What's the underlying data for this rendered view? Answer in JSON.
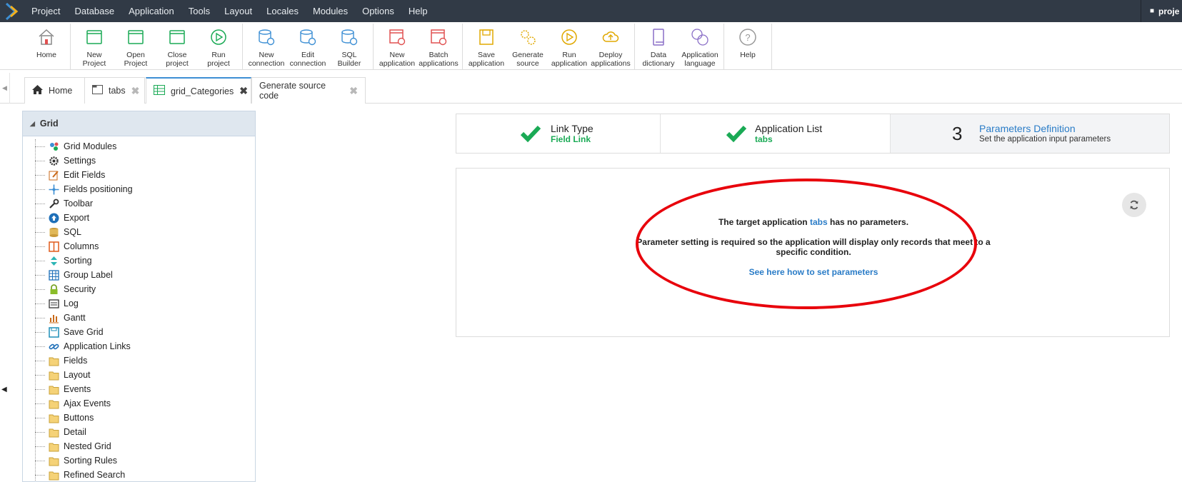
{
  "menu": [
    "Project",
    "Database",
    "Application",
    "Tools",
    "Layout",
    "Locales",
    "Modules",
    "Options",
    "Help"
  ],
  "project_tab": "proje",
  "toolbar": {
    "groups": [
      [
        {
          "l1": "Home",
          "l2": "",
          "icon": "home-icon"
        }
      ],
      [
        {
          "l1": "New",
          "l2": "Project",
          "icon": "new-project-icon"
        },
        {
          "l1": "Open",
          "l2": "Project",
          "icon": "open-project-icon"
        },
        {
          "l1": "Close",
          "l2": "project",
          "icon": "close-project-icon"
        },
        {
          "l1": "Run",
          "l2": "project",
          "icon": "run-project-icon"
        }
      ],
      [
        {
          "l1": "New",
          "l2": "connection",
          "icon": "new-connection-icon"
        },
        {
          "l1": "Edit",
          "l2": "connection",
          "icon": "edit-connection-icon"
        },
        {
          "l1": "SQL",
          "l2": "Builder",
          "icon": "sql-builder-icon"
        }
      ],
      [
        {
          "l1": "New",
          "l2": "application",
          "icon": "new-application-icon"
        },
        {
          "l1": "Batch",
          "l2": "applications",
          "icon": "batch-applications-icon"
        }
      ],
      [
        {
          "l1": "Save",
          "l2": "application",
          "icon": "save-application-icon"
        },
        {
          "l1": "Generate",
          "l2": "source",
          "icon": "generate-source-icon"
        },
        {
          "l1": "Run",
          "l2": "application",
          "icon": "run-application-icon"
        },
        {
          "l1": "Deploy",
          "l2": "applications",
          "icon": "deploy-applications-icon"
        }
      ],
      [
        {
          "l1": "Data",
          "l2": "dictionary",
          "icon": "data-dictionary-icon"
        },
        {
          "l1": "Application",
          "l2": "language",
          "icon": "application-language-icon"
        }
      ],
      [
        {
          "l1": "Help",
          "l2": "",
          "icon": "help-icon"
        }
      ]
    ]
  },
  "tabs": {
    "home": "Home",
    "tabs": "tabs",
    "grid_categories": "grid_Categories",
    "generate": "Generate source code"
  },
  "tree": {
    "header": "Grid",
    "items": [
      {
        "label": "Grid Modules",
        "icon": "grid-modules-icon"
      },
      {
        "label": "Settings",
        "icon": "gear-icon"
      },
      {
        "label": "Edit Fields",
        "icon": "edit-fields-icon"
      },
      {
        "label": "Fields positioning",
        "icon": "move-icon"
      },
      {
        "label": "Toolbar",
        "icon": "wrench-icon"
      },
      {
        "label": "Export",
        "icon": "export-icon"
      },
      {
        "label": "SQL",
        "icon": "database-icon"
      },
      {
        "label": "Columns",
        "icon": "columns-icon"
      },
      {
        "label": "Sorting",
        "icon": "sorting-icon"
      },
      {
        "label": "Group Label",
        "icon": "table-icon"
      },
      {
        "label": "Security",
        "icon": "lock-icon"
      },
      {
        "label": "Log",
        "icon": "log-icon"
      },
      {
        "label": "Gantt",
        "icon": "gantt-icon"
      },
      {
        "label": "Save Grid",
        "icon": "save-icon"
      },
      {
        "label": "Application Links",
        "icon": "link-icon"
      },
      {
        "label": "Fields",
        "icon": "folder-icon"
      },
      {
        "label": "Layout",
        "icon": "folder-icon"
      },
      {
        "label": "Events",
        "icon": "folder-icon"
      },
      {
        "label": "Ajax Events",
        "icon": "folder-icon"
      },
      {
        "label": "Buttons",
        "icon": "folder-icon"
      },
      {
        "label": "Detail",
        "icon": "folder-icon"
      },
      {
        "label": "Nested Grid",
        "icon": "folder-icon"
      },
      {
        "label": "Sorting Rules",
        "icon": "folder-icon"
      },
      {
        "label": "Refined Search",
        "icon": "folder-icon"
      }
    ]
  },
  "steps": {
    "s1": {
      "title": "Link Type",
      "sub": "Field Link"
    },
    "s2": {
      "title": "Application List",
      "sub": "tabs"
    },
    "s3": {
      "num": "3",
      "title": "Parameters Definition",
      "sub": "Set the application input parameters"
    }
  },
  "message": {
    "line1_pre": "The target application",
    "line1_link": "tabs",
    "line1_post": "has no parameters.",
    "line2": "Parameter setting is required so the application will display only records that meet to a specific condition.",
    "help_link": "See here how to set parameters"
  },
  "colors": {
    "accent": "#2a7cc7",
    "success": "#1aaa55",
    "highlight": "#e8000b",
    "menubar": "#313a46"
  }
}
